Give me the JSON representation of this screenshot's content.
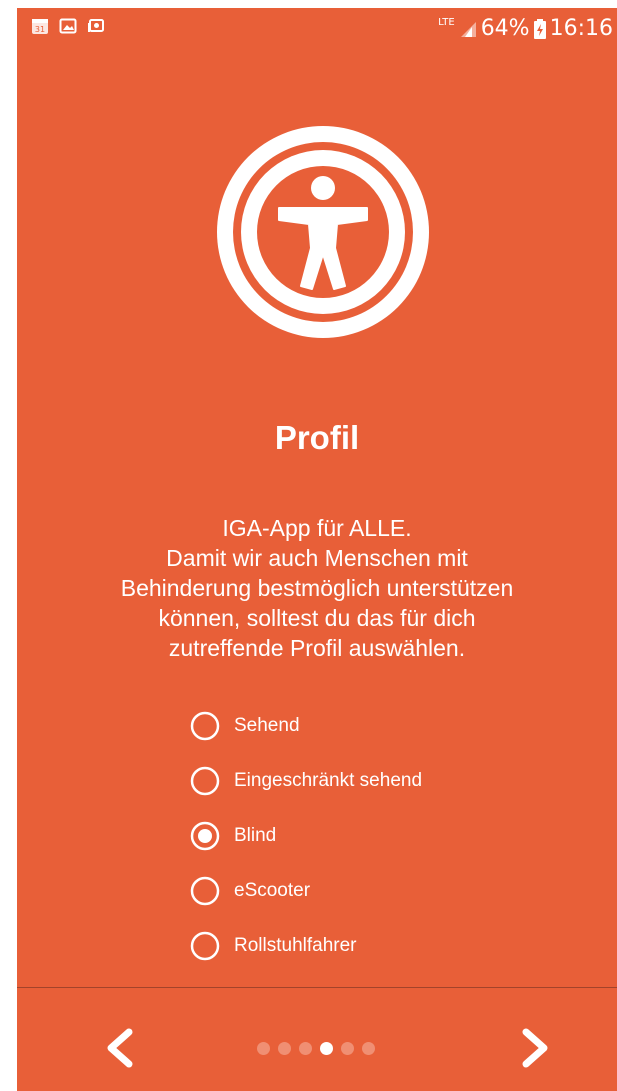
{
  "status_bar": {
    "icons": [
      "calendar-icon",
      "gallery-icon",
      "cast-icon"
    ],
    "calendar_day": "31",
    "network": "LTE",
    "battery": "64%",
    "time": "16:16"
  },
  "page": {
    "icon": "accessibility-icon",
    "title": "Profil",
    "description_lines": [
      "IGA-App für ALLE.",
      "Damit wir auch Menschen mit",
      "Behinderung bestmöglich unterstützen",
      "können, solltest du das für dich",
      "zutreffende Profil auswählen."
    ]
  },
  "profile_options": [
    {
      "label": "Sehend",
      "selected": false
    },
    {
      "label": "Eingeschränkt sehend",
      "selected": false
    },
    {
      "label": "Blind",
      "selected": true
    },
    {
      "label": "eScooter",
      "selected": false
    },
    {
      "label": "Rollstuhlfahrer",
      "selected": false
    }
  ],
  "navigation": {
    "prev_icon": "chevron-left-icon",
    "next_icon": "chevron-right-icon",
    "page_count": 6,
    "current_page": 4
  },
  "colors": {
    "background": "#e85f38",
    "foreground": "#ffffff",
    "dot_inactive": "#f08f73",
    "divider": "#a3432a"
  }
}
